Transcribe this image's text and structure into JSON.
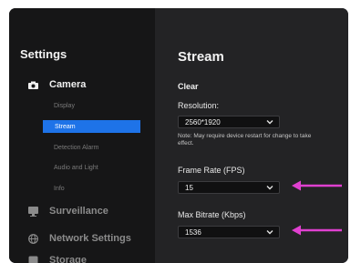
{
  "sidebar": {
    "title": "Settings",
    "camera": {
      "label": "Camera",
      "icon": "camera-icon"
    },
    "camera_items": [
      {
        "label": "Display"
      },
      {
        "label": "Stream"
      },
      {
        "label": "Detection Alarm"
      },
      {
        "label": "Audio and Light"
      },
      {
        "label": "Info"
      }
    ],
    "surveillance": {
      "label": "Surveillance",
      "icon": "surveillance-icon"
    },
    "network": {
      "label": "Network Settings",
      "icon": "globe-icon"
    },
    "storage": {
      "label": "Storage",
      "icon": "storage-icon"
    }
  },
  "main": {
    "title": "Stream",
    "section": "Clear",
    "resolution": {
      "label": "Resolution:",
      "value": "2560*1920",
      "note": "Note: May require device restart for change to take effect."
    },
    "frame_rate": {
      "label": "Frame Rate (FPS)",
      "value": "15"
    },
    "max_bitrate": {
      "label": "Max Bitrate (Kbps)",
      "value": "1536"
    }
  },
  "colors": {
    "accent": "#1e73e8",
    "arrow": "#e040d0"
  }
}
